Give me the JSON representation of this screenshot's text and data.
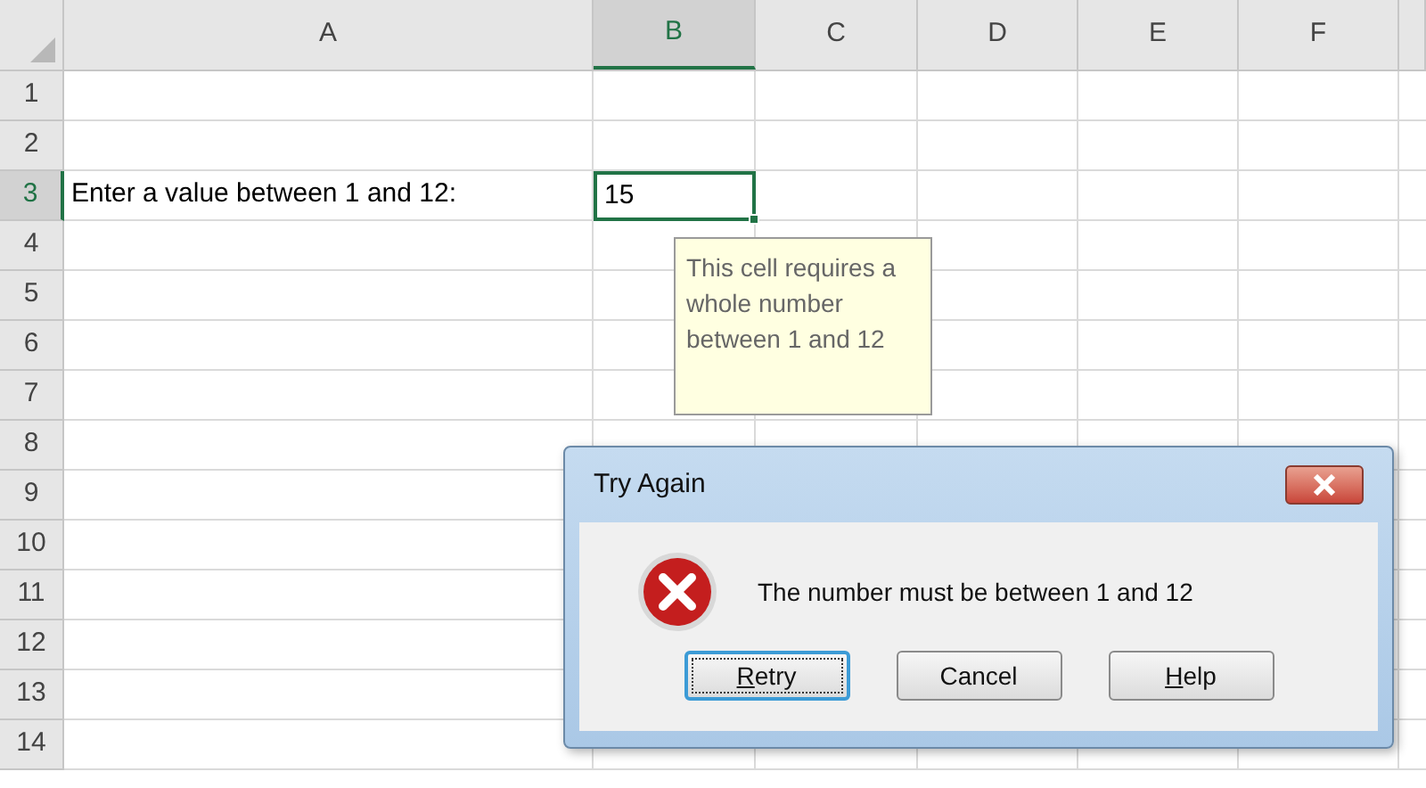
{
  "columns": [
    {
      "label": "A",
      "selected": false
    },
    {
      "label": "B",
      "selected": true
    },
    {
      "label": "C",
      "selected": false
    },
    {
      "label": "D",
      "selected": false
    },
    {
      "label": "E",
      "selected": false
    },
    {
      "label": "F",
      "selected": false
    }
  ],
  "rows": [
    {
      "label": "1",
      "selected": false
    },
    {
      "label": "2",
      "selected": false
    },
    {
      "label": "3",
      "selected": true,
      "cells": [
        {
          "text": "Enter a value between 1 and 12:",
          "selected": false
        },
        {
          "text": "15",
          "selected": true
        }
      ]
    },
    {
      "label": "4",
      "selected": false
    },
    {
      "label": "5",
      "selected": false
    },
    {
      "label": "6",
      "selected": false
    },
    {
      "label": "7",
      "selected": false
    },
    {
      "label": "8",
      "selected": false
    },
    {
      "label": "9",
      "selected": false
    },
    {
      "label": "10",
      "selected": false
    },
    {
      "label": "11",
      "selected": false
    },
    {
      "label": "12",
      "selected": false
    },
    {
      "label": "13",
      "selected": false
    },
    {
      "label": "14",
      "selected": false
    }
  ],
  "input_tooltip": {
    "text": "This cell requires a whole number between 1 and 12"
  },
  "dialog": {
    "title": "Try Again",
    "message": "The number must be between 1 and 12",
    "buttons": [
      {
        "access_key": "R",
        "label": "etry",
        "focused": true
      },
      {
        "label": "Cancel",
        "focused": false
      },
      {
        "access_key": "H",
        "label": "elp",
        "focused": false
      }
    ]
  }
}
